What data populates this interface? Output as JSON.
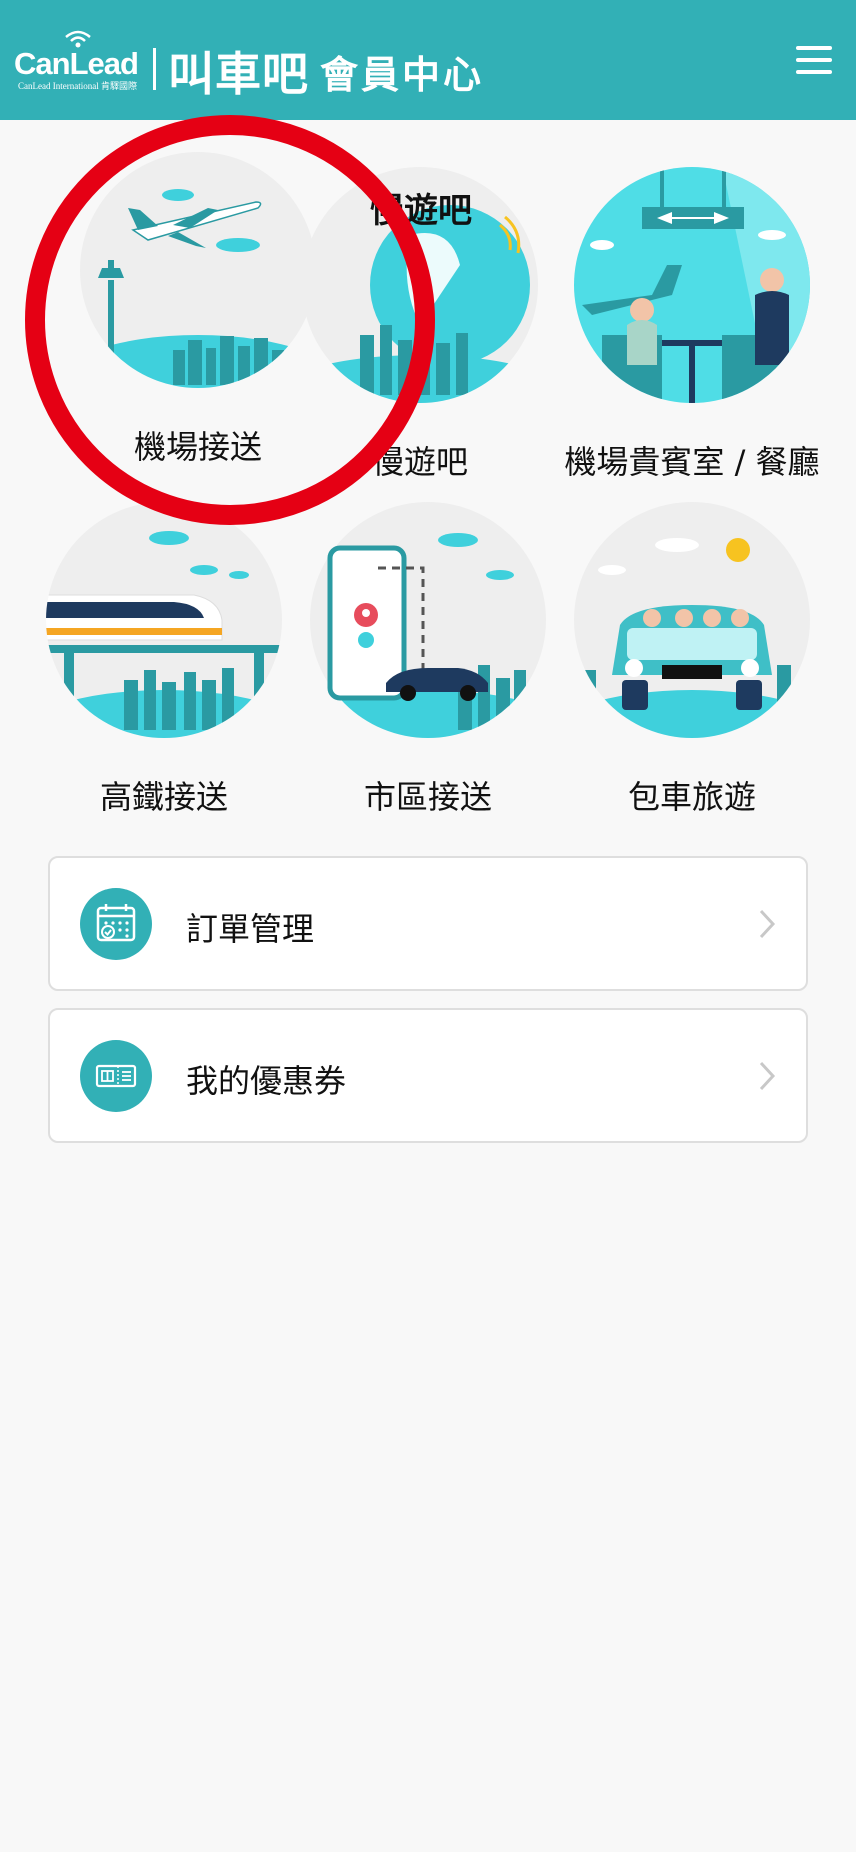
{
  "header": {
    "logo_brand": "CanLead",
    "logo_sub": "CanLead International 肯驛國際",
    "app_name": "叫車吧",
    "section": "會員中心"
  },
  "services": [
    {
      "label": "機場接送",
      "icon": "airport-transfer-icon"
    },
    {
      "label": "慢遊吧",
      "icon": "slow-travel-icon"
    },
    {
      "label": "機場貴賓室 / 餐廳",
      "icon": "airport-lounge-icon"
    },
    {
      "label": "高鐵接送",
      "icon": "high-speed-rail-icon"
    },
    {
      "label": "市區接送",
      "icon": "city-transfer-icon"
    },
    {
      "label": "包車旅遊",
      "icon": "charter-tour-icon"
    }
  ],
  "slow_travel_logo": "慢遊吧",
  "menu": [
    {
      "label": "訂單管理",
      "icon": "calendar-icon"
    },
    {
      "label": "我的優惠券",
      "icon": "coupon-icon"
    }
  ],
  "colors": {
    "header": "#32b0b6",
    "accent": "#3fd0dc",
    "highlight_ring": "#e50014",
    "background": "#f8f8f8"
  }
}
